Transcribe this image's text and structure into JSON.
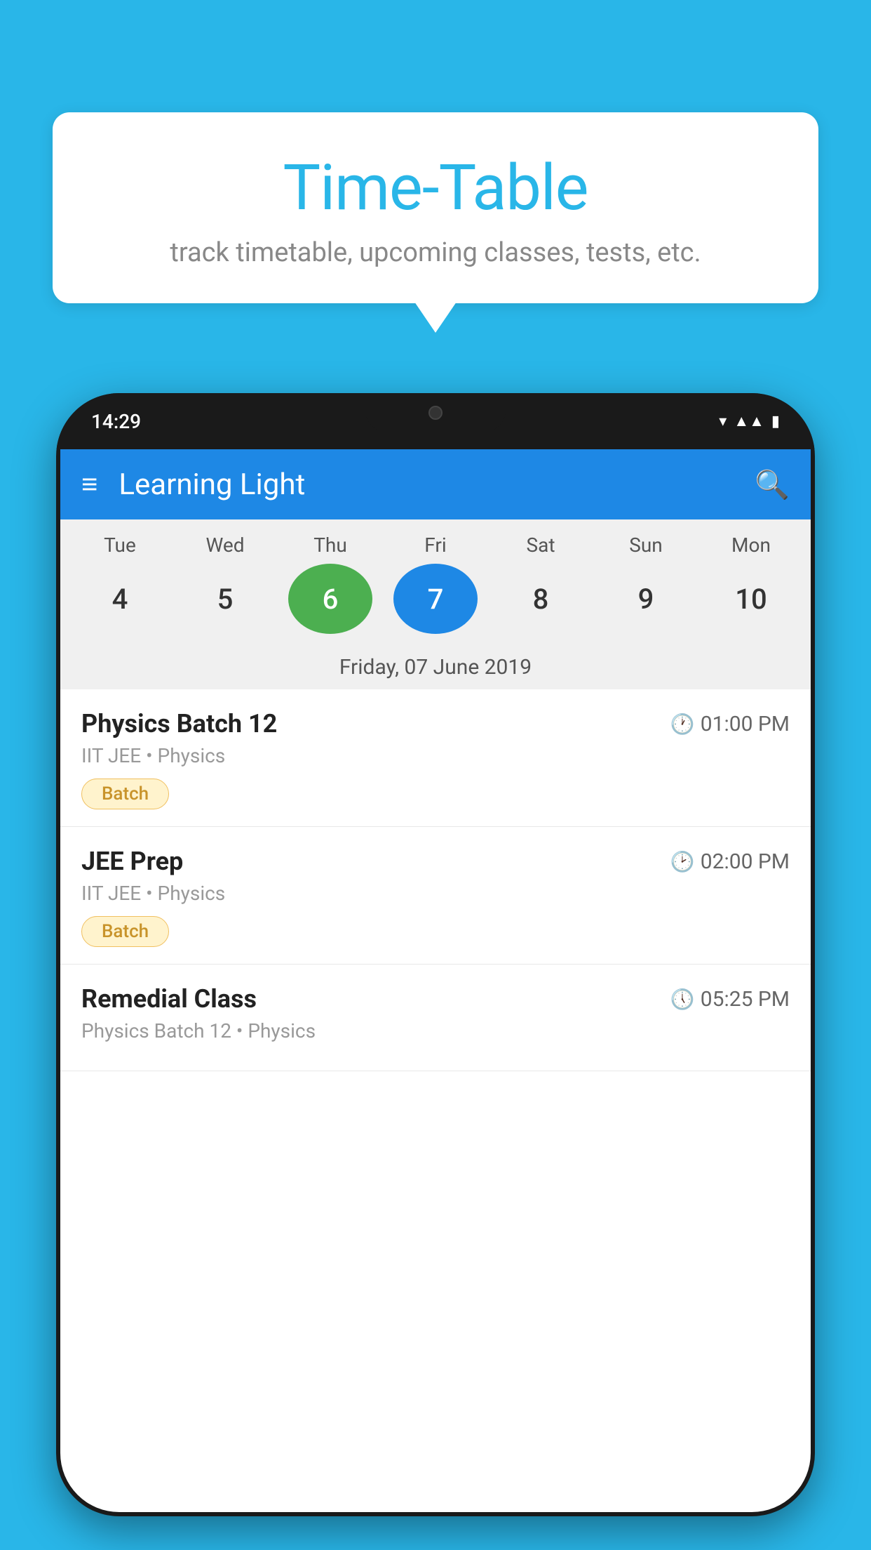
{
  "background": {
    "color": "#29b6e8"
  },
  "speechBubble": {
    "title": "Time-Table",
    "subtitle": "track timetable, upcoming classes, tests, etc."
  },
  "phone": {
    "statusBar": {
      "time": "14:29"
    },
    "appHeader": {
      "title": "Learning Light"
    },
    "calendar": {
      "days": [
        {
          "label": "Tue",
          "number": "4"
        },
        {
          "label": "Wed",
          "number": "5"
        },
        {
          "label": "Thu",
          "number": "6",
          "state": "today"
        },
        {
          "label": "Fri",
          "number": "7",
          "state": "selected"
        },
        {
          "label": "Sat",
          "number": "8"
        },
        {
          "label": "Sun",
          "number": "9"
        },
        {
          "label": "Mon",
          "number": "10"
        }
      ],
      "selectedDateLabel": "Friday, 07 June 2019"
    },
    "schedule": [
      {
        "title": "Physics Batch 12",
        "time": "01:00 PM",
        "subtitle": "IIT JEE • Physics",
        "tag": "Batch"
      },
      {
        "title": "JEE Prep",
        "time": "02:00 PM",
        "subtitle": "IIT JEE • Physics",
        "tag": "Batch"
      },
      {
        "title": "Remedial Class",
        "time": "05:25 PM",
        "subtitle": "Physics Batch 12 • Physics",
        "tag": null
      }
    ]
  }
}
